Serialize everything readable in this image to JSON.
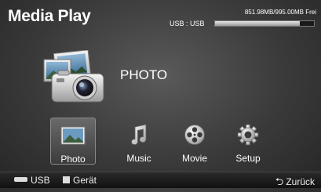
{
  "header": {
    "title": "Media Play",
    "usb_label": "USB : USB",
    "storage_text": "851.98MB/995.00MB Frei",
    "storage_used_fraction": 0.856
  },
  "hero": {
    "label": "PHOTO",
    "icon": "photo-camera-icon"
  },
  "menu": {
    "selected": "Photo",
    "items": [
      {
        "label": "Photo",
        "icon": "photo-icon"
      },
      {
        "label": "Music",
        "icon": "music-note-icon"
      },
      {
        "label": "Movie",
        "icon": "film-reel-icon"
      },
      {
        "label": "Setup",
        "icon": "gear-icon"
      }
    ]
  },
  "footer": {
    "usb_label": "USB",
    "device_label": "Gerät",
    "back_label": "Zurück"
  }
}
